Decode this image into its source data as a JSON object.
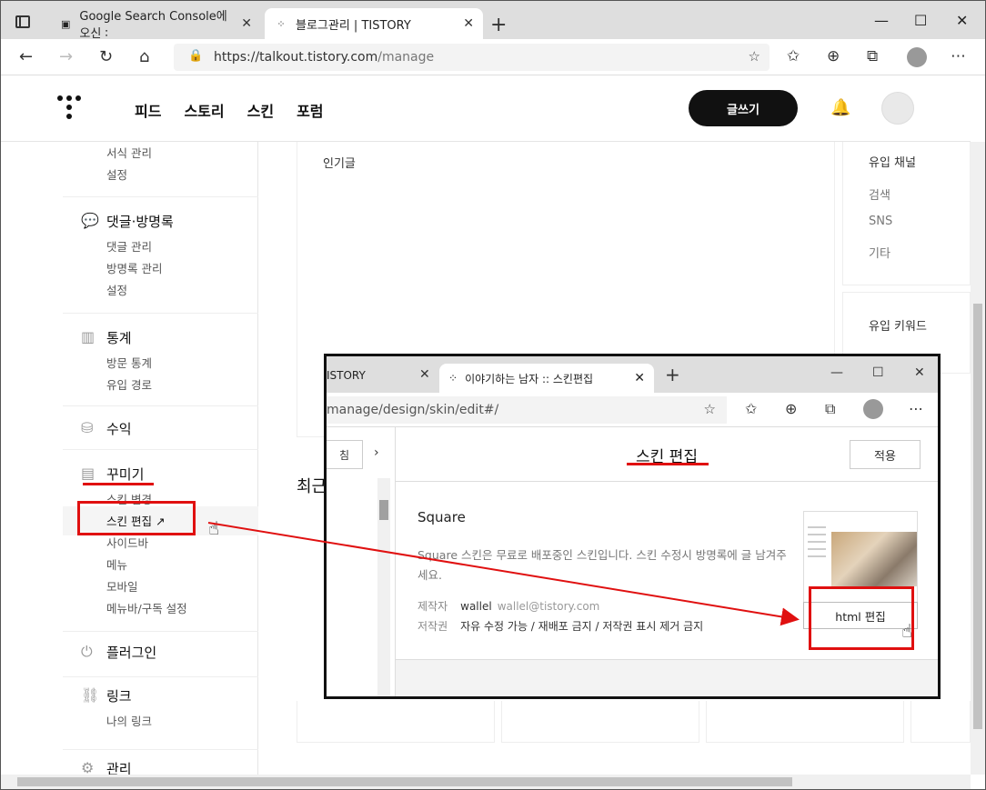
{
  "browser": {
    "tabs": [
      {
        "title": "Google Search Console에 오신 ∶",
        "active": false
      },
      {
        "title": "블로그관리 | TISTORY",
        "active": true
      }
    ],
    "url_host": "https://talkout.tistory.com",
    "url_path": "/manage"
  },
  "header": {
    "nav": [
      "피드",
      "스토리",
      "스킨",
      "포럼"
    ],
    "write_label": "글쓰기"
  },
  "sidebar": {
    "top_items": [
      "서식 관리",
      "설정"
    ],
    "groups": [
      {
        "title": "댓글·방명록",
        "icon": "comment-icon",
        "items": [
          "댓글 관리",
          "방명록 관리",
          "설정"
        ]
      },
      {
        "title": "통계",
        "icon": "bar-chart-icon",
        "items": [
          "방문 통계",
          "유입 경로"
        ]
      },
      {
        "title": "수익",
        "icon": "coins-icon",
        "items": []
      },
      {
        "title": "꾸미기",
        "icon": "layout-icon",
        "items": [
          "스킨 변경",
          "스킨 편집",
          "사이드바",
          "메뉴",
          "모바일",
          "메뉴바/구독 설정"
        ]
      },
      {
        "title": "플러그인",
        "icon": "plug-icon",
        "items": []
      },
      {
        "title": "링크",
        "icon": "link-icon",
        "items": [
          "나의 링크"
        ]
      },
      {
        "title": "관리",
        "icon": "gear-icon",
        "items": []
      }
    ]
  },
  "main": {
    "popular_title": "인기글",
    "recent_title": "최근",
    "inflow_title": "유입 채널",
    "inflow_items": [
      "검색",
      "SNS",
      "기타"
    ],
    "keyword_title": "유입 키워드"
  },
  "inset": {
    "left_tab": "ISTORY",
    "tab_title": "이야기하는 남자 :: 스킨편집",
    "url": "manage/design/skin/edit#/",
    "left_button": "침",
    "panel_title": "스킨 편집",
    "apply_label": "적용",
    "skin_name": "Square",
    "skin_desc": "Square 스킨은 무료로 배포중인 스킨입니다. 스킨 수정시 방명록에 글 남겨주세요.",
    "author_key": "제작자",
    "author_name": "wallel",
    "author_email": "wallel@tistory.com",
    "copyright_key": "저작권",
    "copyright_value": "자유 수정 가능 / 재배포 금지 / 저작권 표시 제거 금지",
    "html_edit_label": "html 편집"
  },
  "colors": {
    "accent_red": "#e01010",
    "brand_black": "#111111"
  }
}
